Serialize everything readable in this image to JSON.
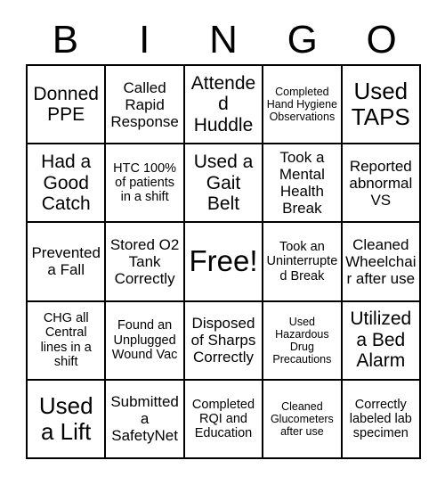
{
  "header": {
    "letters": [
      "B",
      "I",
      "N",
      "G",
      "O"
    ]
  },
  "grid": {
    "rows": [
      [
        {
          "text": "Donned PPE",
          "size": "sz-lg"
        },
        {
          "text": "Called Rapid Response",
          "size": "sz-md"
        },
        {
          "text": "Attended Huddle",
          "size": "sz-lg"
        },
        {
          "text": "Completed Hand Hygiene Observations",
          "size": "sz-xs"
        },
        {
          "text": "Used TAPS",
          "size": "sz-xl"
        }
      ],
      [
        {
          "text": "Had a Good Catch",
          "size": "sz-lg"
        },
        {
          "text": "HTC 100% of patients in a shift",
          "size": "sz-sm"
        },
        {
          "text": "Used a Gait Belt",
          "size": "sz-lg"
        },
        {
          "text": "Took a Mental Health Break",
          "size": "sz-md"
        },
        {
          "text": "Reported abnormal VS",
          "size": "sz-md"
        }
      ],
      [
        {
          "text": "Prevented a Fall",
          "size": "sz-md"
        },
        {
          "text": "Stored O2 Tank Correctly",
          "size": "sz-md"
        },
        {
          "text": "Free!",
          "size": "sz-free"
        },
        {
          "text": "Took an Uninterrupted Break",
          "size": "sz-sm"
        },
        {
          "text": "Cleaned Wheelchair after use",
          "size": "sz-md"
        }
      ],
      [
        {
          "text": "CHG all Central lines in a shift",
          "size": "sz-sm"
        },
        {
          "text": "Found an Unplugged Wound Vac",
          "size": "sz-sm"
        },
        {
          "text": "Disposed of Sharps Correctly",
          "size": "sz-md"
        },
        {
          "text": "Used Hazardous Drug Precautions",
          "size": "sz-xs"
        },
        {
          "text": "Utilized a Bed Alarm",
          "size": "sz-lg"
        }
      ],
      [
        {
          "text": "Used a Lift",
          "size": "sz-xl"
        },
        {
          "text": "Submitted a SafetyNet",
          "size": "sz-md"
        },
        {
          "text": "Completed RQI and Education",
          "size": "sz-sm"
        },
        {
          "text": "Cleaned Glucometers after use",
          "size": "sz-xs"
        },
        {
          "text": "Correctly labeled lab specimen",
          "size": "sz-sm"
        }
      ]
    ]
  },
  "colors": {
    "background": "#ffffff",
    "text": "#000000",
    "grid_line": "#000000"
  }
}
